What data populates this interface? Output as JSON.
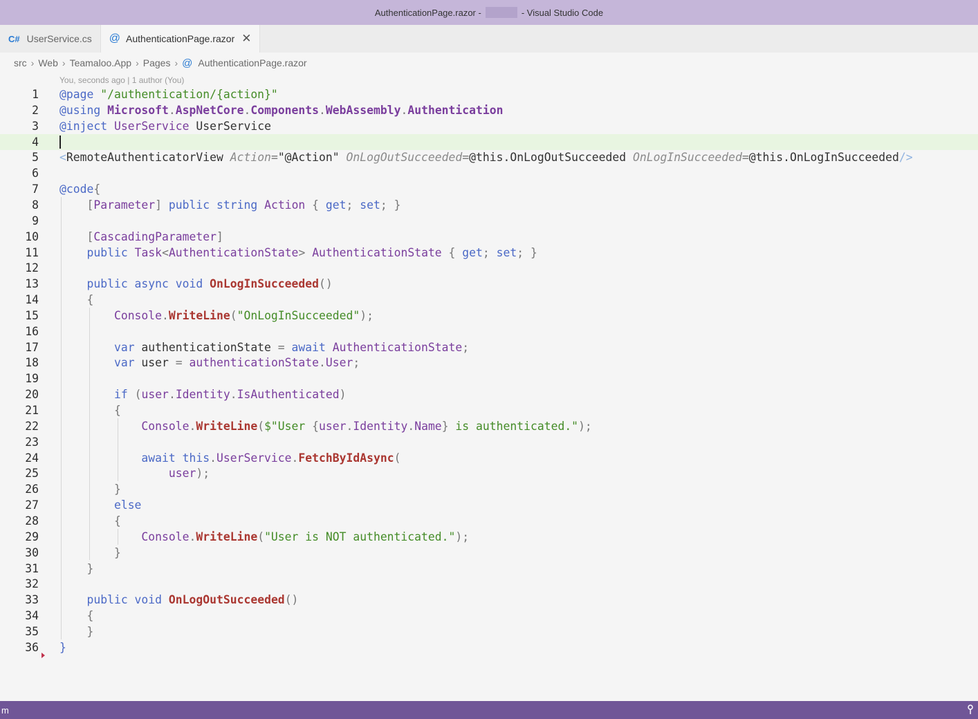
{
  "window": {
    "title_prefix": "AuthenticationPage.razor -",
    "title_suffix": "- Visual Studio Code"
  },
  "tabs": [
    {
      "icon": "C#",
      "label": "UserService.cs",
      "active": false
    },
    {
      "icon": "@",
      "label": "AuthenticationPage.razor",
      "active": true,
      "close": "✕"
    }
  ],
  "breadcrumb": [
    "src",
    "Web",
    "Teamaloo.App",
    "Pages",
    "AuthenticationPage.razor"
  ],
  "breadcrumb_sep": "›",
  "codelens": "You, seconds ago | 1 author (You)",
  "lines": [
    [
      [
        "dir",
        "@page"
      ],
      [
        "id",
        " "
      ],
      [
        "str",
        "\"/authentication/{action}\""
      ]
    ],
    [
      [
        "dir",
        "@using"
      ],
      [
        "id",
        " "
      ],
      [
        "tyb",
        "Microsoft"
      ],
      [
        "pn",
        "."
      ],
      [
        "tyb",
        "AspNetCore"
      ],
      [
        "pn",
        "."
      ],
      [
        "tyb",
        "Components"
      ],
      [
        "pn",
        "."
      ],
      [
        "tyb",
        "WebAssembly"
      ],
      [
        "pn",
        "."
      ],
      [
        "tyb",
        "Authentication"
      ]
    ],
    [
      [
        "dir",
        "@inject"
      ],
      [
        "id",
        " "
      ],
      [
        "ty",
        "UserService"
      ],
      [
        "id",
        " UserService"
      ]
    ],
    [],
    [
      [
        "tag",
        "<"
      ],
      [
        "id",
        "RemoteAuthenticatorView "
      ],
      [
        "ita",
        "Action"
      ],
      [
        "pn",
        "="
      ],
      [
        "id",
        "\"@Action\" "
      ],
      [
        "ita",
        "OnLogOutSucceeded"
      ],
      [
        "pn",
        "="
      ],
      [
        "id",
        "@this.OnLogOutSucceeded "
      ],
      [
        "ita",
        "OnLogInSucceeded"
      ],
      [
        "pn",
        "="
      ],
      [
        "id",
        "@this.OnLogInSucceeded"
      ],
      [
        "tag",
        "/>"
      ]
    ],
    [],
    [
      [
        "dir",
        "@code"
      ],
      [
        "pn",
        "{"
      ]
    ],
    [
      [
        "id",
        "    "
      ],
      [
        "pn",
        "["
      ],
      [
        "ty",
        "Parameter"
      ],
      [
        "pn",
        "] "
      ],
      [
        "kw",
        "public string"
      ],
      [
        "id",
        " "
      ],
      [
        "ty",
        "Action"
      ],
      [
        "pn",
        " { "
      ],
      [
        "kw",
        "get"
      ],
      [
        "pn",
        "; "
      ],
      [
        "kw",
        "set"
      ],
      [
        "pn",
        "; }"
      ]
    ],
    [],
    [
      [
        "id",
        "    "
      ],
      [
        "pn",
        "["
      ],
      [
        "ty",
        "CascadingParameter"
      ],
      [
        "pn",
        "]"
      ]
    ],
    [
      [
        "id",
        "    "
      ],
      [
        "kw",
        "public"
      ],
      [
        "id",
        " "
      ],
      [
        "ty",
        "Task"
      ],
      [
        "pn",
        "<"
      ],
      [
        "ty",
        "AuthenticationState"
      ],
      [
        "pn",
        "> "
      ],
      [
        "ty",
        "AuthenticationState"
      ],
      [
        "pn",
        " { "
      ],
      [
        "kw",
        "get"
      ],
      [
        "pn",
        "; "
      ],
      [
        "kw",
        "set"
      ],
      [
        "pn",
        "; }"
      ]
    ],
    [],
    [
      [
        "id",
        "    "
      ],
      [
        "kw",
        "public async void"
      ],
      [
        "id",
        " "
      ],
      [
        "fn",
        "OnLogInSucceeded"
      ],
      [
        "pn",
        "()"
      ]
    ],
    [
      [
        "id",
        "    "
      ],
      [
        "pn",
        "{"
      ]
    ],
    [
      [
        "id",
        "        "
      ],
      [
        "ty",
        "Console"
      ],
      [
        "pn",
        "."
      ],
      [
        "fn",
        "WriteLine"
      ],
      [
        "pn",
        "("
      ],
      [
        "str",
        "\"OnLogInSucceeded\""
      ],
      [
        "pn",
        ");"
      ]
    ],
    [],
    [
      [
        "id",
        "        "
      ],
      [
        "kw",
        "var"
      ],
      [
        "id",
        " authenticationState "
      ],
      [
        "pn",
        "="
      ],
      [
        "id",
        " "
      ],
      [
        "kw",
        "await"
      ],
      [
        "id",
        " "
      ],
      [
        "ty",
        "AuthenticationState"
      ],
      [
        "pn",
        ";"
      ]
    ],
    [
      [
        "id",
        "        "
      ],
      [
        "kw",
        "var"
      ],
      [
        "id",
        " user "
      ],
      [
        "pn",
        "="
      ],
      [
        "id",
        " "
      ],
      [
        "ty",
        "authenticationState"
      ],
      [
        "pn",
        "."
      ],
      [
        "ty",
        "User"
      ],
      [
        "pn",
        ";"
      ]
    ],
    [],
    [
      [
        "id",
        "        "
      ],
      [
        "kw",
        "if"
      ],
      [
        "pn",
        " ("
      ],
      [
        "ty",
        "user"
      ],
      [
        "pn",
        "."
      ],
      [
        "ty",
        "Identity"
      ],
      [
        "pn",
        "."
      ],
      [
        "ty",
        "IsAuthenticated"
      ],
      [
        "pn",
        ")"
      ]
    ],
    [
      [
        "id",
        "        "
      ],
      [
        "pn",
        "{"
      ]
    ],
    [
      [
        "id",
        "            "
      ],
      [
        "ty",
        "Console"
      ],
      [
        "pn",
        "."
      ],
      [
        "fn",
        "WriteLine"
      ],
      [
        "pn",
        "("
      ],
      [
        "str",
        "$\"User "
      ],
      [
        "pn",
        "{"
      ],
      [
        "ty",
        "user"
      ],
      [
        "pn",
        "."
      ],
      [
        "ty",
        "Identity"
      ],
      [
        "pn",
        "."
      ],
      [
        "ty",
        "Name"
      ],
      [
        "pn",
        "}"
      ],
      [
        "str",
        " is authenticated.\""
      ],
      [
        "pn",
        ");"
      ]
    ],
    [],
    [
      [
        "id",
        "            "
      ],
      [
        "kw",
        "await this"
      ],
      [
        "pn",
        "."
      ],
      [
        "ty",
        "UserService"
      ],
      [
        "pn",
        "."
      ],
      [
        "fn",
        "FetchByIdAsync"
      ],
      [
        "pn",
        "("
      ]
    ],
    [
      [
        "id",
        "                "
      ],
      [
        "ty",
        "user"
      ],
      [
        "pn",
        ");"
      ]
    ],
    [
      [
        "id",
        "        "
      ],
      [
        "pn",
        "}"
      ]
    ],
    [
      [
        "id",
        "        "
      ],
      [
        "kw",
        "else"
      ]
    ],
    [
      [
        "id",
        "        "
      ],
      [
        "pn",
        "{"
      ]
    ],
    [
      [
        "id",
        "            "
      ],
      [
        "ty",
        "Console"
      ],
      [
        "pn",
        "."
      ],
      [
        "fn",
        "WriteLine"
      ],
      [
        "pn",
        "("
      ],
      [
        "str",
        "\"User is NOT authenticated.\""
      ],
      [
        "pn",
        ");"
      ]
    ],
    [
      [
        "id",
        "        "
      ],
      [
        "pn",
        "}"
      ]
    ],
    [
      [
        "id",
        "    "
      ],
      [
        "pn",
        "}"
      ]
    ],
    [],
    [
      [
        "id",
        "    "
      ],
      [
        "kw",
        "public void"
      ],
      [
        "id",
        " "
      ],
      [
        "fn",
        "OnLogOutSucceeded"
      ],
      [
        "pn",
        "()"
      ]
    ],
    [
      [
        "id",
        "    "
      ],
      [
        "pn",
        "{"
      ]
    ],
    [
      [
        "id",
        "    "
      ],
      [
        "pn",
        "}"
      ]
    ],
    [
      [
        "kw",
        "}"
      ]
    ]
  ],
  "current_line": 4,
  "status": {
    "left": "m",
    "right_icon": "source-control-icon"
  },
  "colors": {
    "titlebar": "#c5b6d9",
    "statusbar": "#705697",
    "current_line": "#e8f5e1"
  }
}
